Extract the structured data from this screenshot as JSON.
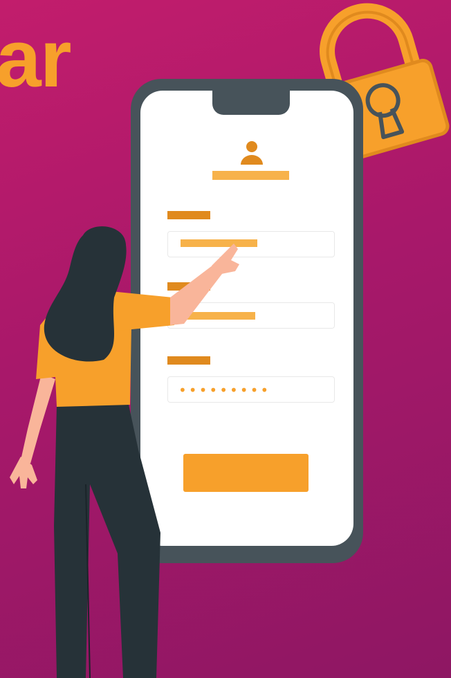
{
  "headline": {
    "text": "ar"
  },
  "login_form": {
    "password_mask": "•••••••••"
  },
  "colors": {
    "background_top": "#c21d6c",
    "background_bottom": "#8e1763",
    "accent": "#f7a02b",
    "accent_dark": "#e08a1e",
    "accent_light": "#f7b24a",
    "phone_frame": "#47535a",
    "hair": "#263238",
    "skin": "#f9b59a"
  },
  "icons": {
    "avatar": "user-icon",
    "lock": "padlock-icon"
  }
}
